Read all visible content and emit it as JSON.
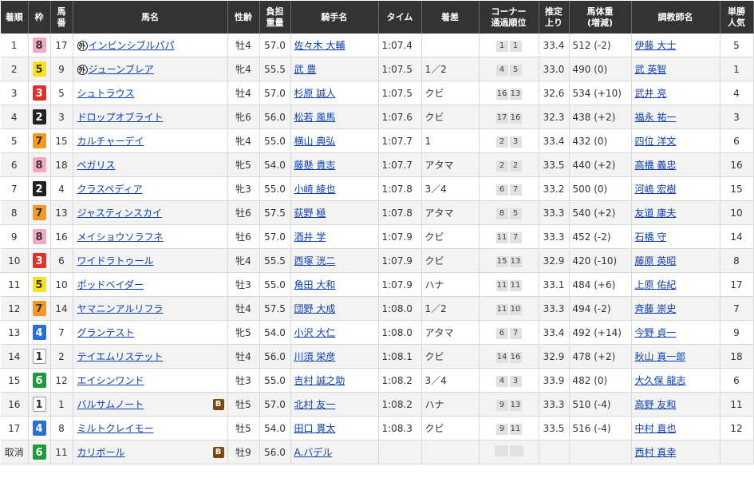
{
  "headers": {
    "finish": "着順",
    "waku": "枠",
    "umaban": [
      "馬",
      "番"
    ],
    "horse": "馬名",
    "sexage": "性齢",
    "weight": [
      "負担",
      "重量"
    ],
    "jockey": "騎手名",
    "time": "タイム",
    "margin": "着差",
    "corner": [
      "コーナー",
      "通過順位"
    ],
    "last3f": [
      "推定",
      "上り"
    ],
    "bodyweight": [
      "馬体重",
      "(増減)"
    ],
    "trainer": "調教師名",
    "popularity": [
      "単勝",
      "人気"
    ]
  },
  "badges": {
    "foreign": "外",
    "blinker": "B"
  },
  "waku_colors": {
    "1": {
      "bg": "#ffffff",
      "fg": "#333333",
      "border": "#999999"
    },
    "2": {
      "bg": "#222222",
      "fg": "#ffffff",
      "border": "#222222"
    },
    "3": {
      "bg": "#e0302b",
      "fg": "#ffffff",
      "border": "#e0302b"
    },
    "4": {
      "bg": "#2a6fd6",
      "fg": "#ffffff",
      "border": "#2a6fd6"
    },
    "5": {
      "bg": "#f7e21b",
      "fg": "#333333",
      "border": "#f7e21b"
    },
    "6": {
      "bg": "#1f9a3d",
      "fg": "#ffffff",
      "border": "#1f9a3d"
    },
    "7": {
      "bg": "#f59a1f",
      "fg": "#333333",
      "border": "#f59a1f"
    },
    "8": {
      "bg": "#f6a8c3",
      "fg": "#333333",
      "border": "#f6a8c3"
    }
  },
  "rows": [
    {
      "finish": "1",
      "waku": "8",
      "umaban": "17",
      "horse": "インビンシブルパパ",
      "foreign": true,
      "blinker": false,
      "sexage": "牡4",
      "weight": "57.0",
      "jockey": "佐々木 大輔",
      "time": "1:07.4",
      "margin": "",
      "corners": [
        "1",
        "1"
      ],
      "last3f": "33.4",
      "bodyweight": "512 (-2)",
      "trainer": "伊藤 大士",
      "popularity": "5"
    },
    {
      "finish": "2",
      "waku": "5",
      "umaban": "9",
      "horse": "ジューンブレア",
      "foreign": true,
      "blinker": false,
      "sexage": "牝4",
      "weight": "55.5",
      "jockey": "武 豊",
      "time": "1:07.5",
      "margin": "1／2",
      "corners": [
        "4",
        "5"
      ],
      "last3f": "33.0",
      "bodyweight": "490 (0)",
      "trainer": "武 英智",
      "popularity": "1"
    },
    {
      "finish": "3",
      "waku": "3",
      "umaban": "5",
      "horse": "シュトラウス",
      "foreign": false,
      "blinker": false,
      "sexage": "牡4",
      "weight": "57.0",
      "jockey": "杉原 誠人",
      "time": "1:07.5",
      "margin": "クビ",
      "corners": [
        "16",
        "13"
      ],
      "last3f": "32.6",
      "bodyweight": "534 (+10)",
      "trainer": "武井 亮",
      "popularity": "4"
    },
    {
      "finish": "4",
      "waku": "2",
      "umaban": "3",
      "horse": "ドロップオブライト",
      "foreign": false,
      "blinker": false,
      "sexage": "牝6",
      "weight": "56.0",
      "jockey": "松若 風馬",
      "time": "1:07.6",
      "margin": "クビ",
      "corners": [
        "17",
        "16"
      ],
      "last3f": "32.3",
      "bodyweight": "438 (+2)",
      "trainer": "福永 祐一",
      "popularity": "3"
    },
    {
      "finish": "5",
      "waku": "7",
      "umaban": "15",
      "horse": "カルチャーデイ",
      "foreign": false,
      "blinker": false,
      "sexage": "牝4",
      "weight": "55.0",
      "jockey": "横山 典弘",
      "time": "1:07.7",
      "margin": "1",
      "corners": [
        "2",
        "3"
      ],
      "last3f": "33.4",
      "bodyweight": "432 (0)",
      "trainer": "四位 洋文",
      "popularity": "6"
    },
    {
      "finish": "6",
      "waku": "8",
      "umaban": "18",
      "horse": "ベガリス",
      "foreign": false,
      "blinker": false,
      "sexage": "牝5",
      "weight": "54.0",
      "jockey": "藤懸 貴志",
      "time": "1:07.7",
      "margin": "アタマ",
      "corners": [
        "2",
        "2"
      ],
      "last3f": "33.5",
      "bodyweight": "440 (+2)",
      "trainer": "高橋 義忠",
      "popularity": "16"
    },
    {
      "finish": "7",
      "waku": "2",
      "umaban": "4",
      "horse": "クラスペディア",
      "foreign": false,
      "blinker": false,
      "sexage": "牝3",
      "weight": "55.0",
      "jockey": "小崎 綾也",
      "time": "1:07.8",
      "margin": "3／4",
      "corners": [
        "6",
        "7"
      ],
      "last3f": "33.2",
      "bodyweight": "500 (0)",
      "trainer": "河嶋 宏樹",
      "popularity": "15"
    },
    {
      "finish": "8",
      "waku": "7",
      "umaban": "13",
      "horse": "ジャスティンスカイ",
      "foreign": false,
      "blinker": false,
      "sexage": "牡6",
      "weight": "57.5",
      "jockey": "荻野 極",
      "time": "1:07.8",
      "margin": "アタマ",
      "corners": [
        "8",
        "5"
      ],
      "last3f": "33.3",
      "bodyweight": "540 (+2)",
      "trainer": "友道 康夫",
      "popularity": "10"
    },
    {
      "finish": "9",
      "waku": "8",
      "umaban": "16",
      "horse": "メイショウソラフネ",
      "foreign": false,
      "blinker": false,
      "sexage": "牡6",
      "weight": "57.0",
      "jockey": "酒井 学",
      "time": "1:07.9",
      "margin": "クビ",
      "corners": [
        "11",
        "7"
      ],
      "last3f": "33.3",
      "bodyweight": "452 (-2)",
      "trainer": "石橋 守",
      "popularity": "14"
    },
    {
      "finish": "10",
      "waku": "3",
      "umaban": "6",
      "horse": "ワイドラトゥール",
      "foreign": false,
      "blinker": false,
      "sexage": "牝4",
      "weight": "55.5",
      "jockey": "西塚 洸二",
      "time": "1:07.9",
      "margin": "クビ",
      "corners": [
        "15",
        "13"
      ],
      "last3f": "32.9",
      "bodyweight": "420 (-10)",
      "trainer": "藤原 英昭",
      "popularity": "8"
    },
    {
      "finish": "11",
      "waku": "5",
      "umaban": "10",
      "horse": "ポッドベイダー",
      "foreign": false,
      "blinker": false,
      "sexage": "牡3",
      "weight": "55.0",
      "jockey": "角田 大和",
      "time": "1:07.9",
      "margin": "ハナ",
      "corners": [
        "11",
        "11"
      ],
      "last3f": "33.1",
      "bodyweight": "484 (+6)",
      "trainer": "上原 佑紀",
      "popularity": "17"
    },
    {
      "finish": "12",
      "waku": "7",
      "umaban": "14",
      "horse": "ヤマニンアルリフラ",
      "foreign": false,
      "blinker": false,
      "sexage": "牡4",
      "weight": "57.5",
      "jockey": "団野 大成",
      "time": "1:08.0",
      "margin": "1／2",
      "corners": [
        "11",
        "10"
      ],
      "last3f": "33.3",
      "bodyweight": "494 (-2)",
      "trainer": "斉藤 崇史",
      "popularity": "7"
    },
    {
      "finish": "13",
      "waku": "4",
      "umaban": "7",
      "horse": "グランテスト",
      "foreign": false,
      "blinker": false,
      "sexage": "牝5",
      "weight": "54.0",
      "jockey": "小沢 大仁",
      "time": "1:08.0",
      "margin": "アタマ",
      "corners": [
        "6",
        "7"
      ],
      "last3f": "33.4",
      "bodyweight": "492 (+14)",
      "trainer": "今野 貞一",
      "popularity": "9"
    },
    {
      "finish": "14",
      "waku": "1",
      "umaban": "2",
      "horse": "テイエムリステット",
      "foreign": false,
      "blinker": false,
      "sexage": "牡4",
      "weight": "56.0",
      "jockey": "川須 栄彦",
      "time": "1:08.1",
      "margin": "クビ",
      "corners": [
        "14",
        "16"
      ],
      "last3f": "32.9",
      "bodyweight": "478 (+2)",
      "trainer": "秋山 真一郎",
      "popularity": "18"
    },
    {
      "finish": "15",
      "waku": "6",
      "umaban": "12",
      "horse": "エイシンワンド",
      "foreign": false,
      "blinker": false,
      "sexage": "牡3",
      "weight": "55.0",
      "jockey": "吉村 誠之助",
      "time": "1:08.2",
      "margin": "3／4",
      "corners": [
        "4",
        "3"
      ],
      "last3f": "33.9",
      "bodyweight": "482 (0)",
      "trainer": "大久保 龍志",
      "popularity": "6"
    },
    {
      "finish": "16",
      "waku": "1",
      "umaban": "1",
      "horse": "バルサムノート",
      "foreign": false,
      "blinker": true,
      "sexage": "牡5",
      "weight": "57.0",
      "jockey": "北村 友一",
      "time": "1:08.2",
      "margin": "ハナ",
      "corners": [
        "9",
        "13"
      ],
      "last3f": "33.3",
      "bodyweight": "510 (-4)",
      "trainer": "高野 友和",
      "popularity": "11"
    },
    {
      "finish": "17",
      "waku": "4",
      "umaban": "8",
      "horse": "ミルトクレイモー",
      "foreign": false,
      "blinker": false,
      "sexage": "牡5",
      "weight": "54.0",
      "jockey": "田口 貫太",
      "time": "1:08.3",
      "margin": "クビ",
      "corners": [
        "9",
        "11"
      ],
      "last3f": "33.5",
      "bodyweight": "516 (-4)",
      "trainer": "中村 直也",
      "popularity": "12"
    },
    {
      "finish": "取消",
      "waku": "6",
      "umaban": "11",
      "horse": "カリボール",
      "foreign": false,
      "blinker": true,
      "sexage": "牡9",
      "weight": "56.0",
      "jockey": "A.バデル",
      "time": "",
      "margin": "",
      "corners": [
        "",
        ""
      ],
      "last3f": "",
      "bodyweight": "",
      "trainer": "西村 真幸",
      "popularity": ""
    }
  ]
}
